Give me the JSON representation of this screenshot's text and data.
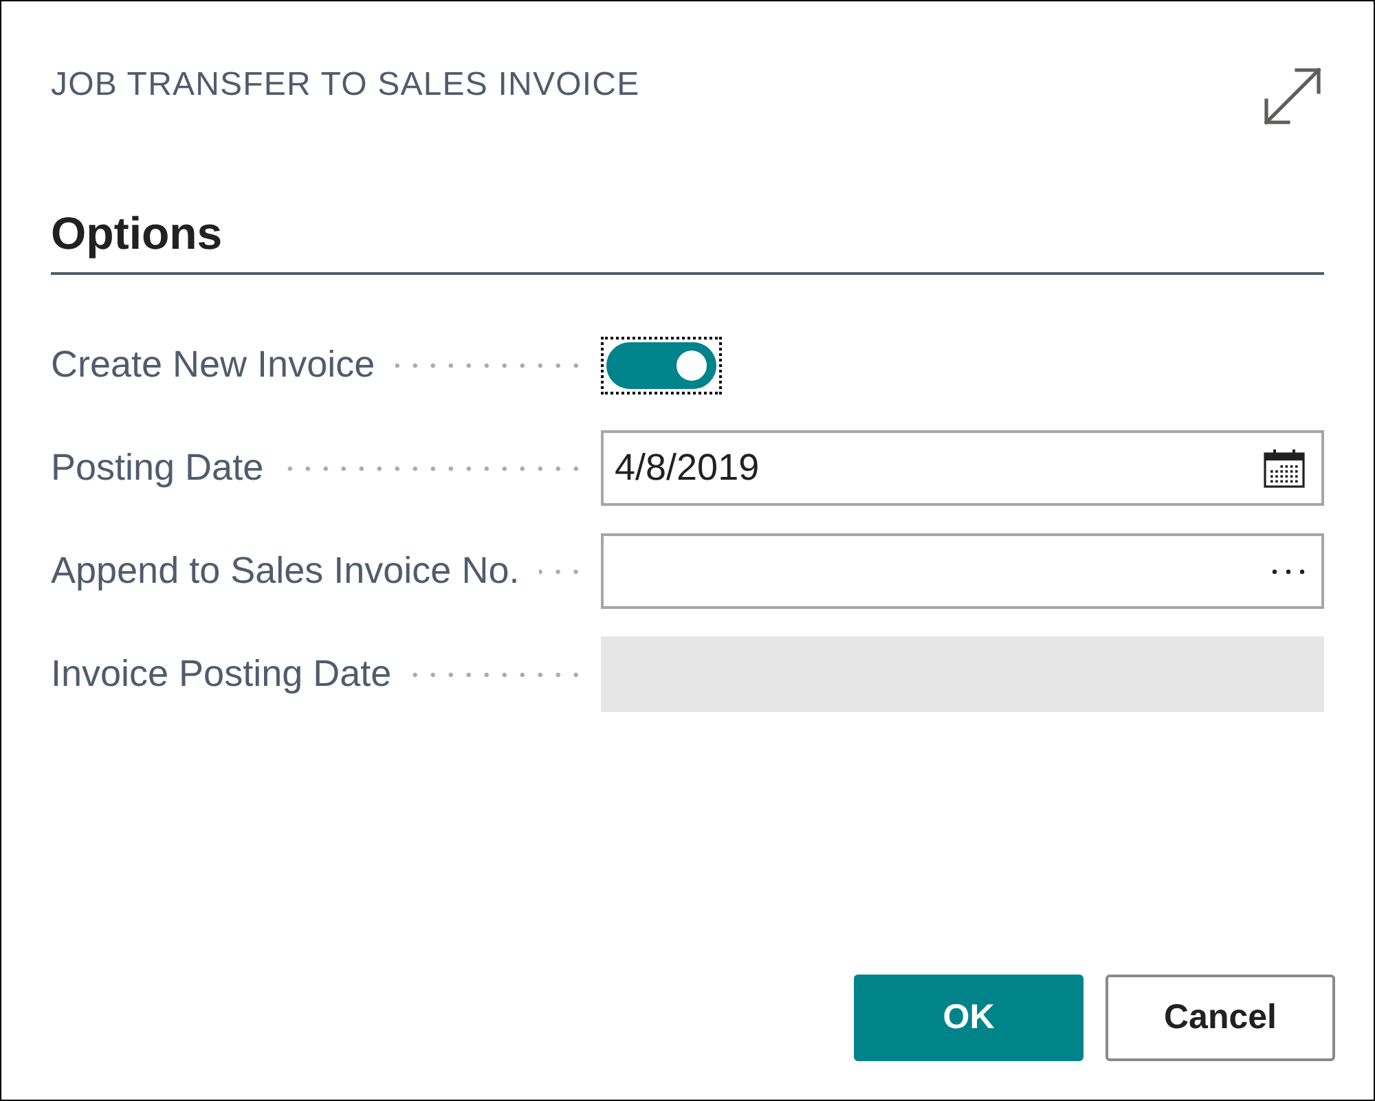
{
  "dialog": {
    "title": "JOB TRANSFER TO SALES INVOICE"
  },
  "section": {
    "title": "Options"
  },
  "fields": [
    {
      "label": "Create New Invoice",
      "kind": "toggle",
      "on": true,
      "focused": true,
      "disabled": false
    },
    {
      "label": "Posting Date",
      "kind": "date",
      "value": "4/8/2019",
      "focused": false,
      "disabled": false
    },
    {
      "label": "Append to Sales Invoice No.",
      "kind": "lookup",
      "focused": false,
      "disabled": false
    },
    {
      "label": "Invoice Posting Date",
      "kind": "text",
      "focused": false,
      "disabled": true
    }
  ],
  "buttons": [
    {
      "label": "OK",
      "kind": "primary"
    },
    {
      "label": "Cancel",
      "kind": "secondary"
    }
  ]
}
